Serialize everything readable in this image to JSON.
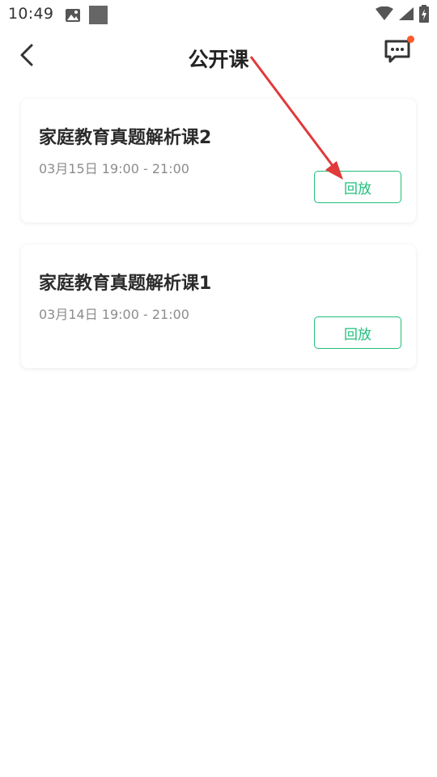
{
  "status_bar": {
    "time": "10:49"
  },
  "header": {
    "title": "公开课"
  },
  "courses": [
    {
      "title": "家庭教育真题解析课2",
      "time": "03月15日 19:00 - 21:00",
      "button_label": "回放"
    },
    {
      "title": "家庭教育真题解析课1",
      "time": "03月14日 19:00 - 21:00",
      "button_label": "回放"
    }
  ],
  "colors": {
    "accent": "#1fbf7a",
    "notification": "#ff5a2c",
    "annotation": "#e03a3a"
  },
  "icons": {
    "back": "chevron-left-icon",
    "message": "chat-bubble-icon",
    "image": "image-icon",
    "wifi": "wifi-icon",
    "signal": "signal-icon",
    "battery": "battery-charging-icon"
  }
}
